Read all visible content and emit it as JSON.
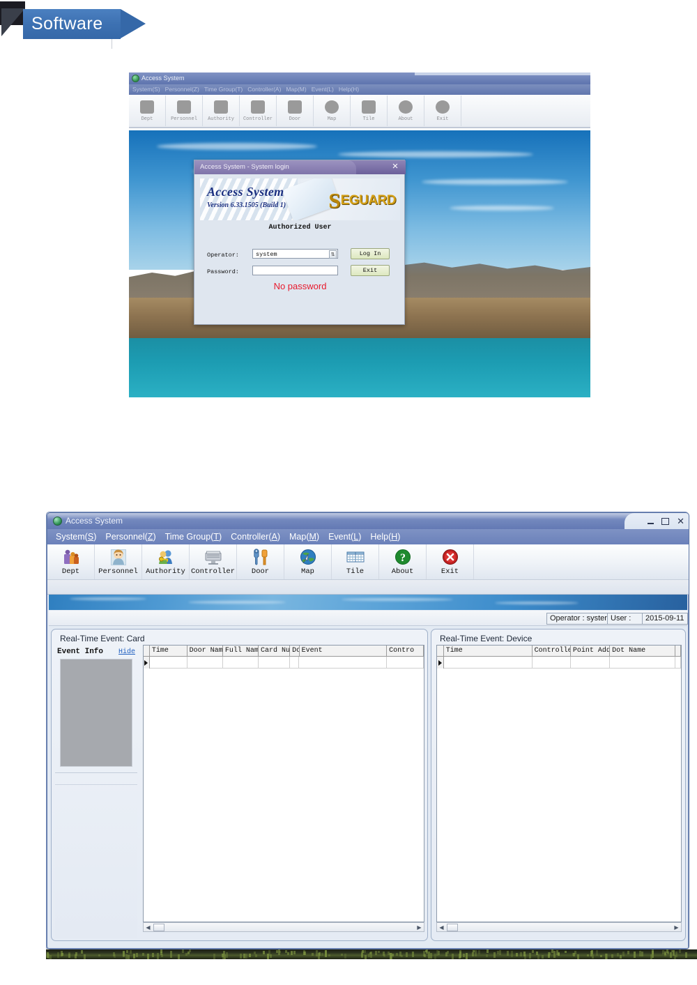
{
  "banner": {
    "label": "Software"
  },
  "login_window": {
    "title": "Access System",
    "menu": [
      {
        "label": "System(S)"
      },
      {
        "label": "Personnel(Z)"
      },
      {
        "label": "Time Group(T)"
      },
      {
        "label": "Controller(A)"
      },
      {
        "label": "Map(M)"
      },
      {
        "label": "Event(L)"
      },
      {
        "label": "Help(H)"
      }
    ],
    "toolbar": [
      {
        "label": "Dept",
        "icon": "dept-icon"
      },
      {
        "label": "Personnel",
        "icon": "personnel-icon"
      },
      {
        "label": "Authority",
        "icon": "authority-icon"
      },
      {
        "label": "Controller",
        "icon": "controller-icon"
      },
      {
        "label": "Door",
        "icon": "door-icon"
      },
      {
        "label": "Map",
        "icon": "map-icon"
      },
      {
        "label": "Tile",
        "icon": "tile-icon"
      },
      {
        "label": "About",
        "icon": "about-icon"
      },
      {
        "label": "Exit",
        "icon": "exit-icon"
      }
    ],
    "dialog": {
      "title": "Access System - System login",
      "close_icon": "×",
      "product_name": "Access System",
      "version": "Version 6.33.1505 (Build 1)",
      "logo_s": "S",
      "logo_rest": "EGUARD",
      "subtitle": "Authorized User",
      "operator_label": "Operator:",
      "operator_value": "system",
      "operator_dropdown_icon": "⇅",
      "password_label": "Password:",
      "password_value": "",
      "login_button": "Log In",
      "exit_button": "Exit",
      "warning": "No password",
      "warning_color": "#e8192c"
    }
  },
  "main_window": {
    "title": "Access System",
    "window_buttons": {
      "minimize": "minimize-icon",
      "maximize": "maximize-icon",
      "close": "✕"
    },
    "menu": [
      {
        "text": "System",
        "key": "S"
      },
      {
        "text": "Personnel",
        "key": "Z"
      },
      {
        "text": "Time Group",
        "key": "T"
      },
      {
        "text": "Controller",
        "key": "A"
      },
      {
        "text": "Map",
        "key": "M"
      },
      {
        "text": "Event",
        "key": "L"
      },
      {
        "text": "Help",
        "key": "H"
      }
    ],
    "toolbar": [
      {
        "label": "Dept",
        "icon": "dept-icon"
      },
      {
        "label": "Personnel",
        "icon": "personnel-icon"
      },
      {
        "label": "Authority",
        "icon": "authority-icon"
      },
      {
        "label": "Controller",
        "icon": "controller-icon"
      },
      {
        "label": "Door",
        "icon": "door-icon"
      },
      {
        "label": "Map",
        "icon": "map-icon"
      },
      {
        "label": "Tile",
        "icon": "tile-icon"
      },
      {
        "label": "About",
        "icon": "about-icon"
      },
      {
        "label": "Exit",
        "icon": "exit-icon"
      }
    ],
    "status": {
      "operator": "Operator : syster",
      "user": "User :",
      "date": "2015-09-11"
    },
    "card_panel": {
      "caption": "Real-Time Event: Card",
      "event_info": {
        "title": "Event Info",
        "hide_link": "Hide"
      },
      "columns": [
        "Time",
        "Door Name",
        "Full Name",
        "Card Numbe",
        "Doo",
        "Event",
        "Contro"
      ],
      "rows": []
    },
    "device_panel": {
      "caption": "Real-Time Event: Device",
      "columns": [
        "Time",
        "Controller",
        "Point Addr",
        "Dot Name",
        ""
      ],
      "rows": []
    },
    "scrollbar": {
      "left_arrow": "◀",
      "right_arrow": "▶"
    }
  }
}
